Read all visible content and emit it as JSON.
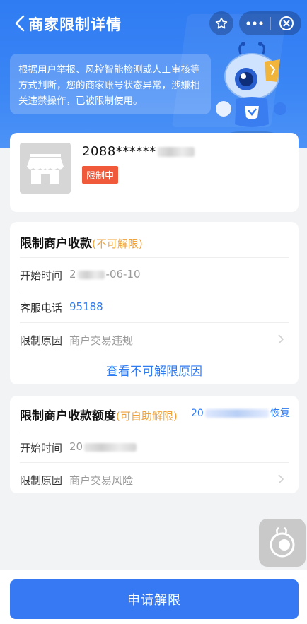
{
  "nav": {
    "title": "商家限制详情",
    "icons": [
      "chevron-left-icon",
      "star-icon",
      "more-icon",
      "close-icon"
    ]
  },
  "notice": {
    "text": "根据用户举报、风控智能检测或人工审核等方式判断，您的商家账号状态异常，涉嫌相关违禁操作，已被限制使用。"
  },
  "merchant": {
    "id_prefix": "2088******",
    "status": "限制中"
  },
  "restriction_payment": {
    "title": "限制商户收款",
    "note": "(不可解限)",
    "rows": [
      {
        "label": "开始时间",
        "value_prefix": "2",
        "value_suffix": "-06-10"
      },
      {
        "label": "客服电话",
        "value": "95188"
      },
      {
        "label": "限制原因",
        "value": "商户交易违规"
      }
    ],
    "link": "查看不可解限原因"
  },
  "restriction_amount": {
    "title": "限制商户收款额度",
    "note": "(可自助解限)",
    "recover_prefix": "20",
    "recover_suffix": "恢复",
    "rows": [
      {
        "label": "开始时间",
        "value_prefix": "20"
      },
      {
        "label": "限制原因",
        "value": "商户交易风险"
      }
    ]
  },
  "footer": {
    "apply_label": "申请解限"
  },
  "colors": {
    "primary": "#3779f2",
    "badge": "#f05a3a",
    "orange_note": "#f0a23a",
    "link": "#2f7bf2"
  }
}
